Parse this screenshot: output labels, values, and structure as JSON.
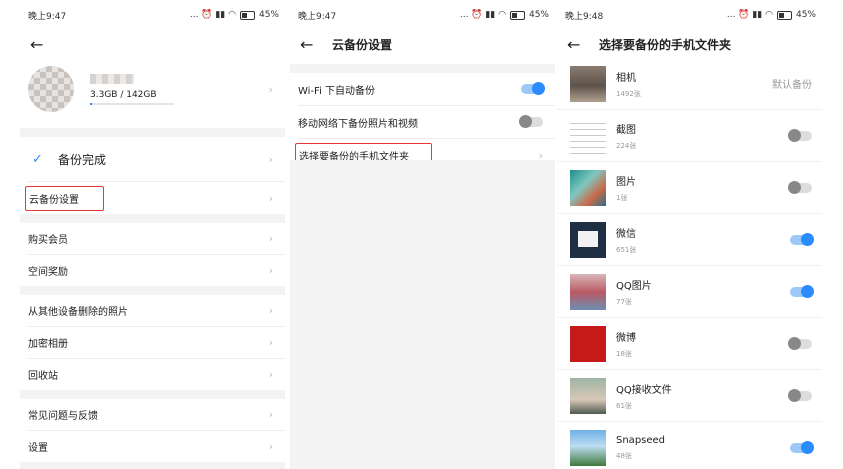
{
  "status_bar": [
    {
      "time": "晚上9:47",
      "battery": "45%",
      "icons": "... ⏰ ▮▮ ◠"
    },
    {
      "time": "晚上9:47",
      "battery": "45%",
      "icons": "... ⏰ ▮▮ ◠"
    },
    {
      "time": "晚上9:48",
      "battery": "45%",
      "icons": "... ⏰ ▮▮ ◠"
    }
  ],
  "screen1": {
    "storage": "3.3GB / 142GB",
    "storage_fraction": 0.023,
    "backup_done": "备份完成",
    "menu": [
      "云备份设置",
      "购买会员",
      "空间奖励",
      "从其他设备删除的照片",
      "加密相册",
      "回收站",
      "常见问题与反馈",
      "设置"
    ]
  },
  "screen2": {
    "title": "云备份设置",
    "wifi_auto": "Wi-Fi 下自动备份",
    "mobile_backup": "移动网络下备份照片和视频",
    "choose_folders": "选择要备份的手机文件夹"
  },
  "screen3": {
    "title": "选择要备份的手机文件夹",
    "default_label": "默认备份",
    "folders": [
      {
        "name": "相机",
        "count": "1492张"
      },
      {
        "name": "截图",
        "count": "224张"
      },
      {
        "name": "图片",
        "count": "1张"
      },
      {
        "name": "微信",
        "count": "651张"
      },
      {
        "name": "QQ图片",
        "count": "77张"
      },
      {
        "name": "微博",
        "count": "18张"
      },
      {
        "name": "QQ接收文件",
        "count": "61张"
      },
      {
        "name": "Snapseed",
        "count": "48张"
      }
    ]
  },
  "icons": {
    "back": "←",
    "chevron": "›",
    "check": "✓"
  },
  "colors": {
    "accent": "#2b8cff",
    "highlight_border": "#e53935"
  }
}
